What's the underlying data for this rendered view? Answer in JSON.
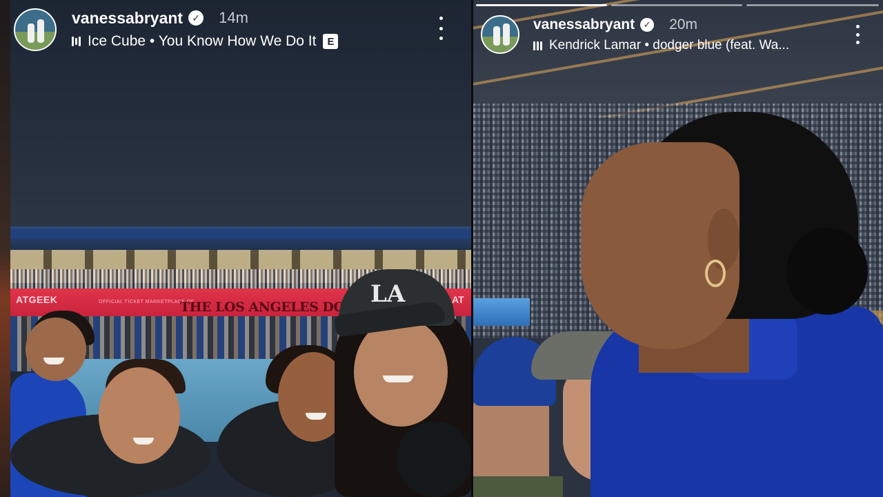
{
  "left_story": {
    "username": "vanessabryant",
    "time": "14m",
    "song": "Ice Cube • You Know How We Do It",
    "explicit_badge": "E",
    "banner_left": "ATGEEK",
    "banner_sub": "OFFICIAL TICKET MARKETPLACE OF",
    "banner_main": "THE LOS ANGELES DODGE",
    "banner_right": "AT",
    "cap_logo": "LA"
  },
  "right_story": {
    "username": "vanessabryant",
    "time": "20m",
    "song": "Kendrick Lamar • dodger blue (feat. Wa..."
  },
  "icons": {
    "verified": "verified-badge-icon",
    "music": "music-bars-icon",
    "more": "more-options-icon"
  },
  "colors": {
    "banner_red": "#d62c42",
    "dodger_blue": "#1836a6"
  }
}
